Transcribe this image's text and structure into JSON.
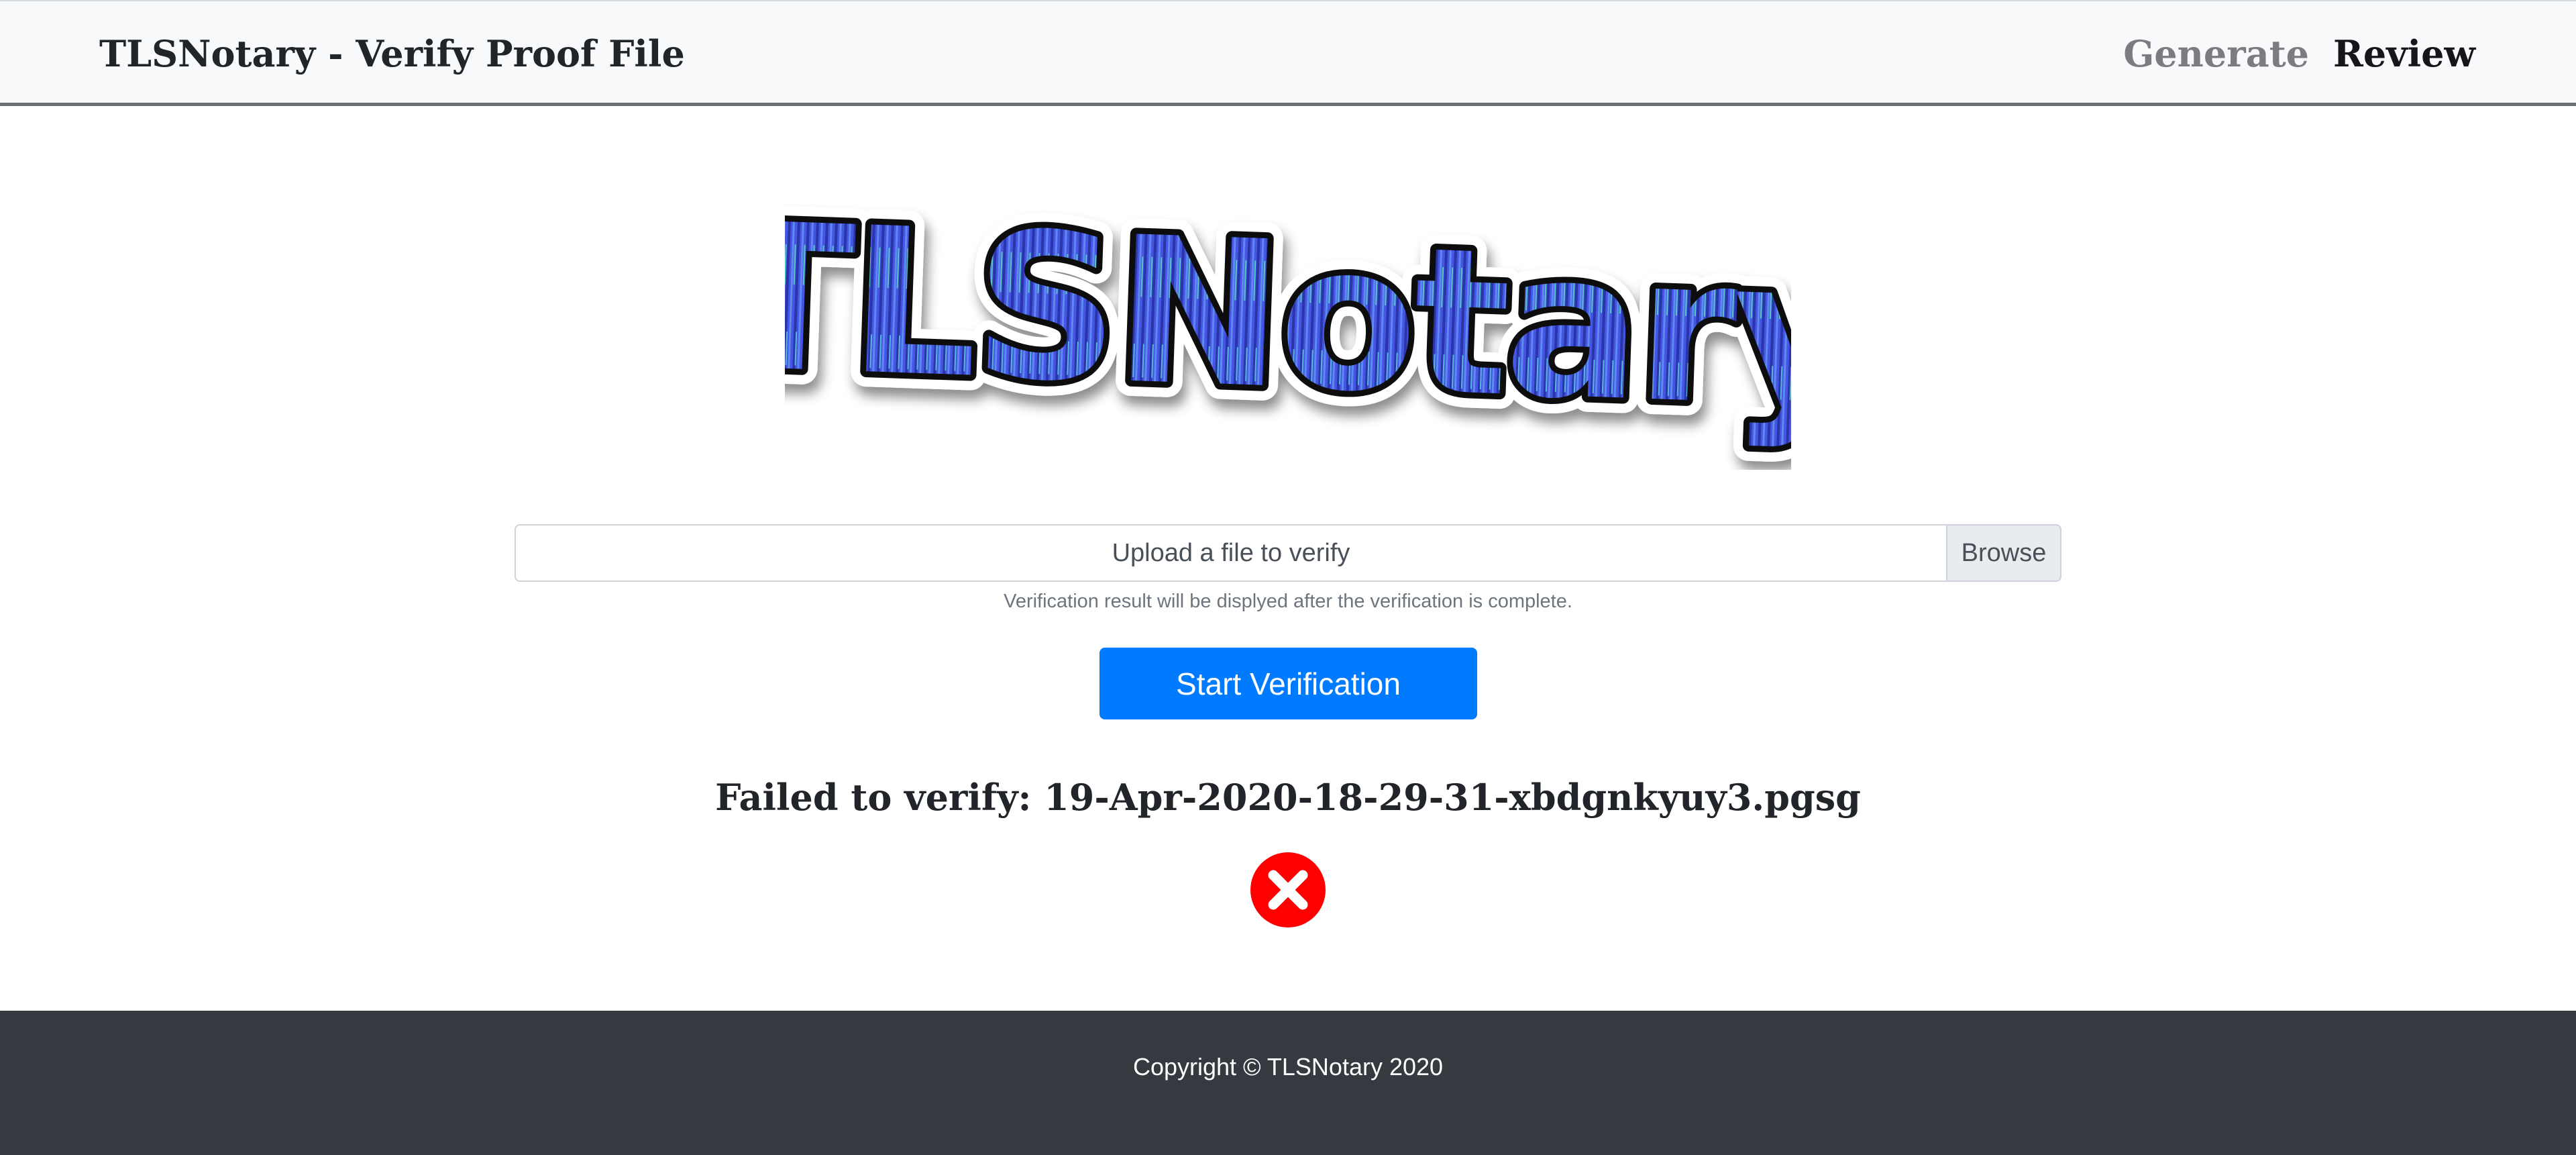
{
  "navbar": {
    "brand": "TLSNotary - Verify Proof File",
    "links": [
      {
        "label": "Generate",
        "state": "inactive"
      },
      {
        "label": "Review",
        "state": "active"
      }
    ]
  },
  "logo": {
    "text": "TLSNotary",
    "icon": "tlsnotary-logo"
  },
  "upload": {
    "placeholder": "Upload a file to verify",
    "browse_label": "Browse",
    "help_text": "Verification result will be displyed after the verification is complete."
  },
  "actions": {
    "start_label": "Start Verification"
  },
  "result": {
    "message": "Failed to verify: 19-Apr-2020-18-29-31-xbdgnkyuy3.pgsg",
    "status": "failed",
    "icon": "error-x-icon",
    "color": "#ff0000"
  },
  "footer": {
    "copyright": "Copyright © TLSNotary 2020"
  },
  "colors": {
    "navbar_bg": "#f8f9fa",
    "primary": "#007bff",
    "footer_bg": "#343a40",
    "logo_fill": "#4a5fe0",
    "logo_outline": "#111111"
  }
}
